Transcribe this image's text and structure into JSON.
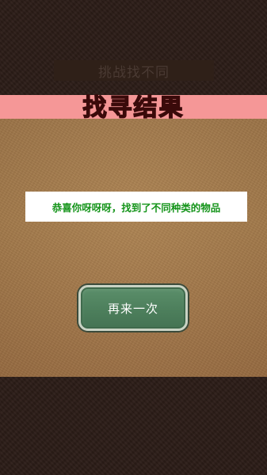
{
  "game": {
    "title": "挑战找不同"
  },
  "result": {
    "heading": "找寻结果",
    "message": "恭喜你呀呀呀，找到了不同种类的物品",
    "retry_label": "再来一次"
  },
  "colors": {
    "heading_text": "#e8081e",
    "heading_strip": "#f59797",
    "message_text": "#14941a",
    "button_fill": "#4d7f5c",
    "panel": "#a3784a",
    "dark_band": "#2b1c17"
  }
}
